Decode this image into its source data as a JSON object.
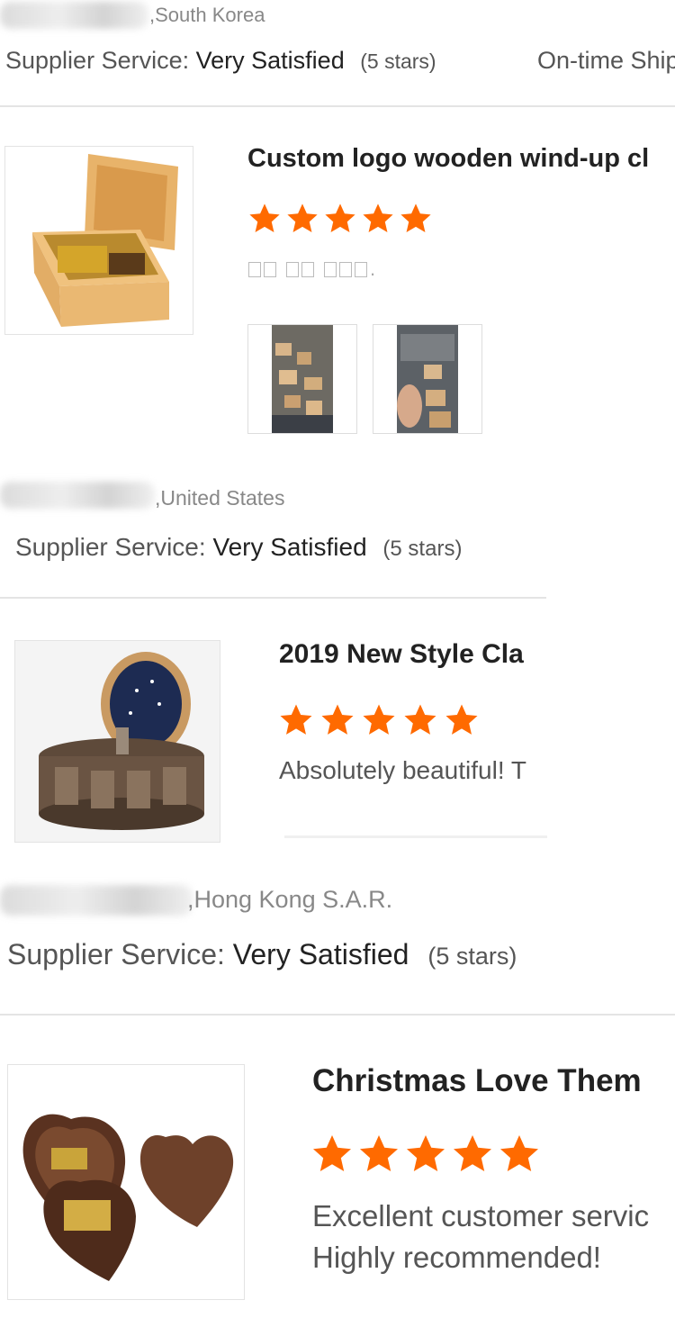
{
  "reviews": [
    {
      "country": ",South Korea",
      "supplier_label": "Supplier Service:",
      "supplier_value": "Very Satisfied",
      "supplier_stars": "(5 stars)",
      "shipment_label": "On-time Ship",
      "title": "Custom logo wooden wind-up cl",
      "rating": 5,
      "review_text": ".",
      "photo_count": 2
    },
    {
      "country": ",United States",
      "supplier_label": "Supplier Service:",
      "supplier_value": "Very Satisfied",
      "supplier_stars": "(5 stars)",
      "title": "2019 New Style Cla",
      "rating": 5,
      "review_text": "Absolutely beautiful! T"
    },
    {
      "country": ",Hong Kong S.A.R.",
      "supplier_label": "Supplier Service:",
      "supplier_value": "Very Satisfied",
      "supplier_stars": "(5 stars)",
      "title": "Christmas Love Them",
      "rating": 5,
      "review_text_line1": "Excellent customer servic",
      "review_text_line2": "Highly recommended!"
    }
  ],
  "colors": {
    "star": "#ff6a00",
    "divider": "#e4e4e4",
    "text_muted": "#888888"
  },
  "icons": {
    "rating": "star-icon",
    "reviewer_name": "blurred-name"
  }
}
